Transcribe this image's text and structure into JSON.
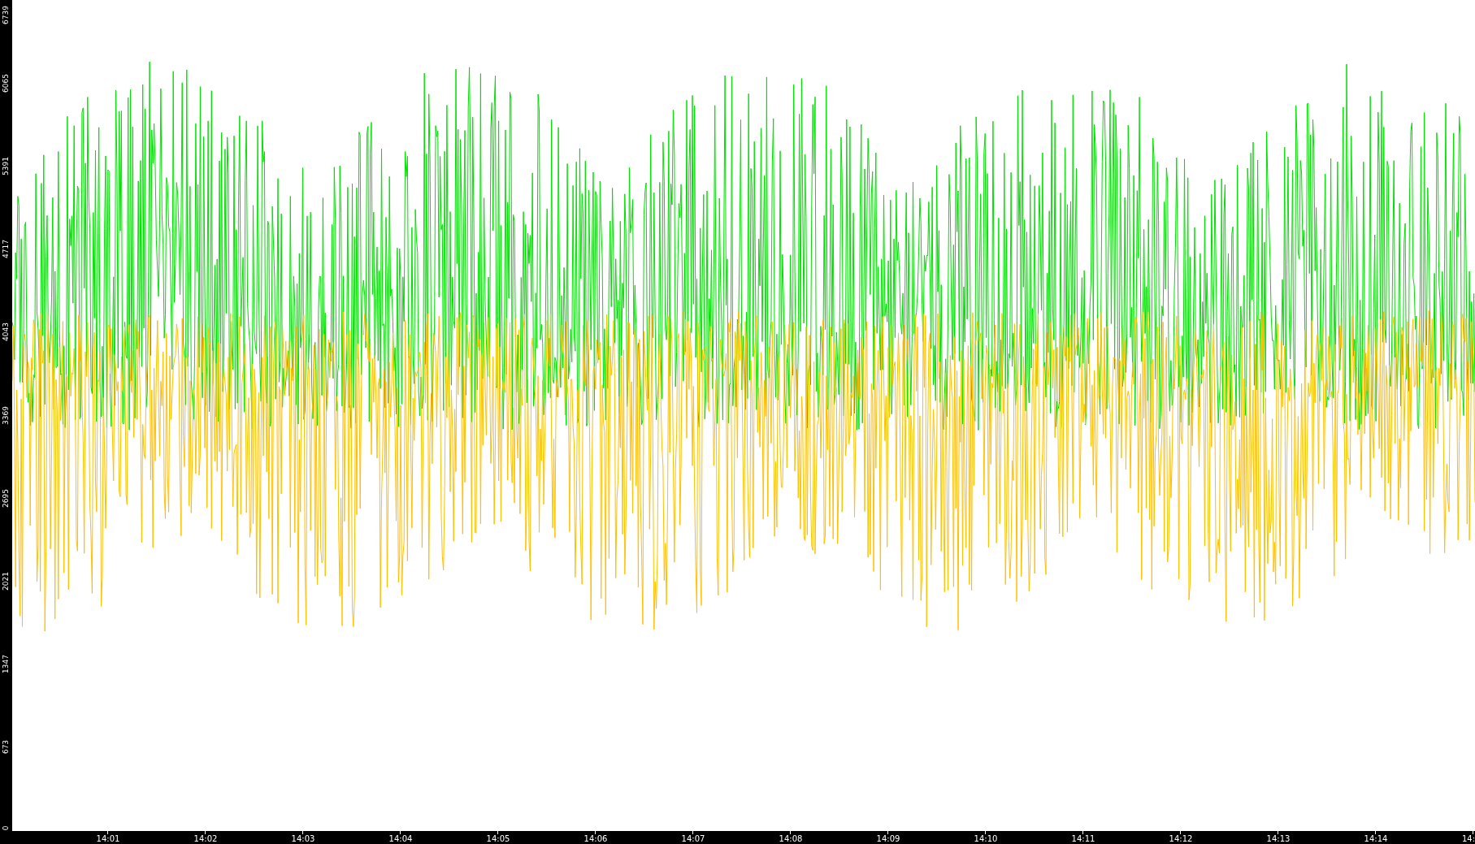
{
  "y_axis": {
    "ticks": [
      "0",
      "673",
      "1347",
      "2021",
      "2695",
      "3369",
      "4043",
      "4717",
      "5391",
      "6065",
      "6739"
    ]
  },
  "x_axis": {
    "ticks": [
      "14:01",
      "14:02",
      "14:03",
      "14:04",
      "14:05",
      "14:06",
      "14:07",
      "14:08",
      "14:09",
      "14:10",
      "14:11",
      "14:12",
      "14:13",
      "14:14",
      "14:"
    ]
  },
  "series": [
    {
      "color": "#00e000"
    },
    {
      "color": "#ffc000"
    }
  ]
}
